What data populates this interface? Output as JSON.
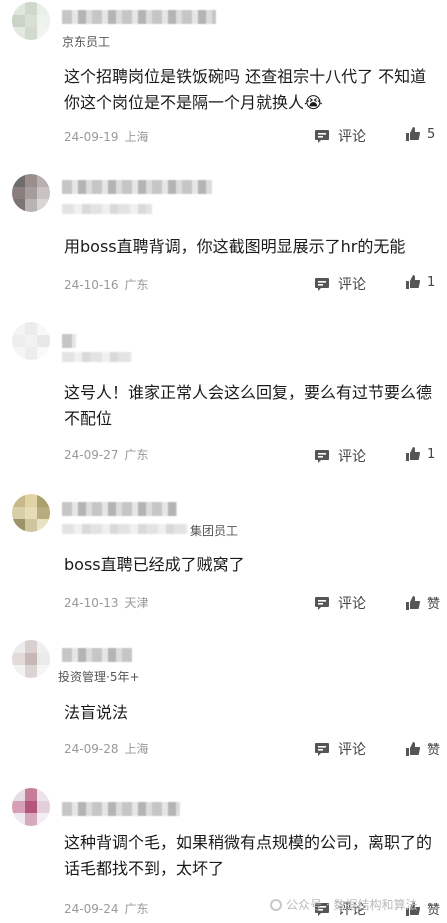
{
  "comments": [
    {
      "tag": "京东员工",
      "text": "这个招聘岗位是铁饭碗吗 还查祖宗十八代了 不知道你这个岗位是不是隔一个月就换人😭",
      "date": "24-09-19",
      "location": "上海",
      "comment_label": "评论",
      "likes": "5"
    },
    {
      "tag": "",
      "text": "用boss直聘背调，你这截图明显展示了hr的无能",
      "date": "24-10-16",
      "location": "广东",
      "comment_label": "评论",
      "likes": "1"
    },
    {
      "tag": "",
      "text": "这号人！谁家正常人会这么回复，要么有过节要么德不配位",
      "date": "24-09-27",
      "location": "广东",
      "comment_label": "评论",
      "likes": "1"
    },
    {
      "tag": "集团员工",
      "text": "boss直聘已经成了贼窝了",
      "date": "24-10-13",
      "location": "天津",
      "comment_label": "评论",
      "likes": "赞"
    },
    {
      "tag": "投资管理·5年+",
      "text": "法盲说法",
      "date": "24-09-28",
      "location": "上海",
      "comment_label": "评论",
      "likes": "赞"
    },
    {
      "tag": "",
      "text": "这种背调个毛，如果稍微有点规模的公司，离职了的话毛都找不到，太坏了",
      "date": "24-09-24",
      "location": "广东",
      "comment_label": "评论",
      "likes": "赞"
    }
  ],
  "watermark": {
    "text": "公众号 · 数据结构和算法"
  },
  "icons": {
    "comment": "comment-bubble-icon",
    "like": "thumbs-up-icon"
  }
}
